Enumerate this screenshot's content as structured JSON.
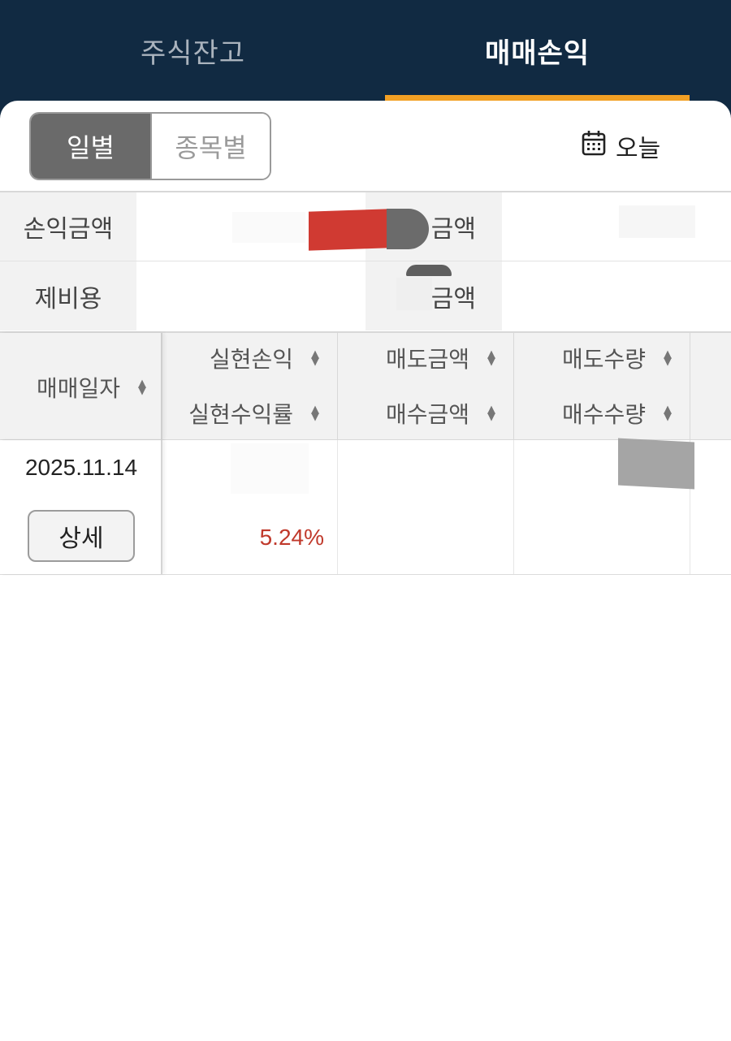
{
  "top_tabs": [
    {
      "label": "주식잔고",
      "active": false
    },
    {
      "label": "매매손익",
      "active": true
    }
  ],
  "colors": {
    "header_bg": "#112a42",
    "active_tab_underline": "#f2a024",
    "profit_red": "#c0392b",
    "toggle_active": "#6a6a6a"
  },
  "view_toggle": {
    "daily": "일별",
    "by_stock": "종목별",
    "selected": "일별"
  },
  "date_button": {
    "icon": "calendar-icon",
    "label": "오늘"
  },
  "summary": {
    "row1": {
      "left_label": "손익금액",
      "left_value": "",
      "right_label": "금액",
      "right_value": ""
    },
    "row2": {
      "left_label": "제비용",
      "left_value": "",
      "right_label": "금액",
      "right_value": ""
    }
  },
  "table": {
    "headers": {
      "date": "매매일자",
      "col1_top": "실현손익",
      "col1_bottom": "실현수익률",
      "col2_top": "매도금액",
      "col2_bottom": "매수금액",
      "col3_top": "매도수량",
      "col3_bottom": "매수수량"
    },
    "rows": [
      {
        "date": "2025.11.14",
        "detail_button": "상세",
        "realized_pl": "",
        "return_rate": "5.24%",
        "sell_amount": "",
        "buy_amount": "",
        "sell_qty": "",
        "buy_qty": ""
      }
    ]
  }
}
